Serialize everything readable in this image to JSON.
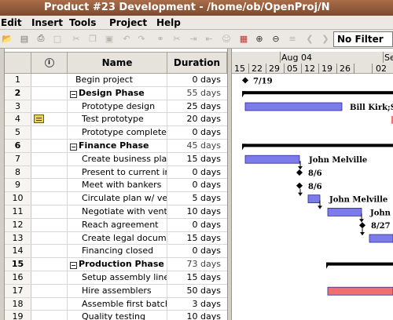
{
  "window": {
    "title": "Product #23 Development - /home/ob/OpenProj/N"
  },
  "menu": [
    "Edit",
    "Insert",
    "Tools",
    "Project",
    "Help"
  ],
  "toolbar": {
    "filter_value": "No Filter"
  },
  "grid": {
    "columns": {
      "name": "Name",
      "duration": "Duration"
    },
    "rows": [
      {
        "id": "1",
        "name": "Begin project",
        "duration": "0 days",
        "summary": false,
        "indent": 1
      },
      {
        "id": "2",
        "name": "Design Phase",
        "duration": "55 days",
        "summary": true,
        "indent": 0
      },
      {
        "id": "3",
        "name": "Prototype design",
        "duration": "25 days",
        "summary": false,
        "indent": 2
      },
      {
        "id": "4",
        "name": "Test prototype",
        "duration": "20 days",
        "summary": false,
        "indent": 2,
        "note": true
      },
      {
        "id": "5",
        "name": "Prototype completed",
        "duration": "0 days",
        "summary": false,
        "indent": 2
      },
      {
        "id": "6",
        "name": "Finance Phase",
        "duration": "45 days",
        "summary": true,
        "indent": 0
      },
      {
        "id": "7",
        "name": "Create business plan",
        "duration": "15 days",
        "summary": false,
        "indent": 2
      },
      {
        "id": "8",
        "name": "Present to current inve",
        "duration": "0 days",
        "summary": false,
        "indent": 2
      },
      {
        "id": "9",
        "name": "Meet with bankers",
        "duration": "0 days",
        "summary": false,
        "indent": 2
      },
      {
        "id": "10",
        "name": "Circulate plan w/ ventu",
        "duration": "5 days",
        "summary": false,
        "indent": 2
      },
      {
        "id": "11",
        "name": "Negotiate with venture",
        "duration": "10 days",
        "summary": false,
        "indent": 2
      },
      {
        "id": "12",
        "name": "Reach agreement",
        "duration": "0 days",
        "summary": false,
        "indent": 2
      },
      {
        "id": "13",
        "name": "Create legal document",
        "duration": "15 days",
        "summary": false,
        "indent": 2
      },
      {
        "id": "14",
        "name": "Financing closed",
        "duration": "0 days",
        "summary": false,
        "indent": 2
      },
      {
        "id": "15",
        "name": "Production Phase",
        "duration": "73 days",
        "summary": true,
        "indent": 0
      },
      {
        "id": "16",
        "name": "Setup assembly line",
        "duration": "15 days",
        "summary": false,
        "indent": 2
      },
      {
        "id": "17",
        "name": "Hire assemblers",
        "duration": "50 days",
        "summary": false,
        "indent": 2
      },
      {
        "id": "18",
        "name": "Assemble first batch",
        "duration": "3 days",
        "summary": false,
        "indent": 2
      },
      {
        "id": "19",
        "name": "Quality testing",
        "duration": "10 days",
        "summary": false,
        "indent": 2
      }
    ]
  },
  "gantt": {
    "months": [
      "Aug 04",
      "Sep"
    ],
    "days": [
      "15",
      "22",
      "29",
      "05",
      "12",
      "19",
      "26",
      "02"
    ],
    "labels": {
      "r1": "7/19",
      "r3": "Bill Kirk;Sc",
      "r7": "John Melville",
      "r8": "8/6",
      "r9": "8/6",
      "r10": "John Melville",
      "r11": "John M",
      "r12": "8/27"
    },
    "colors": {
      "task": "#7b7bea",
      "summary": "#000000",
      "critical": "#f07070"
    }
  }
}
